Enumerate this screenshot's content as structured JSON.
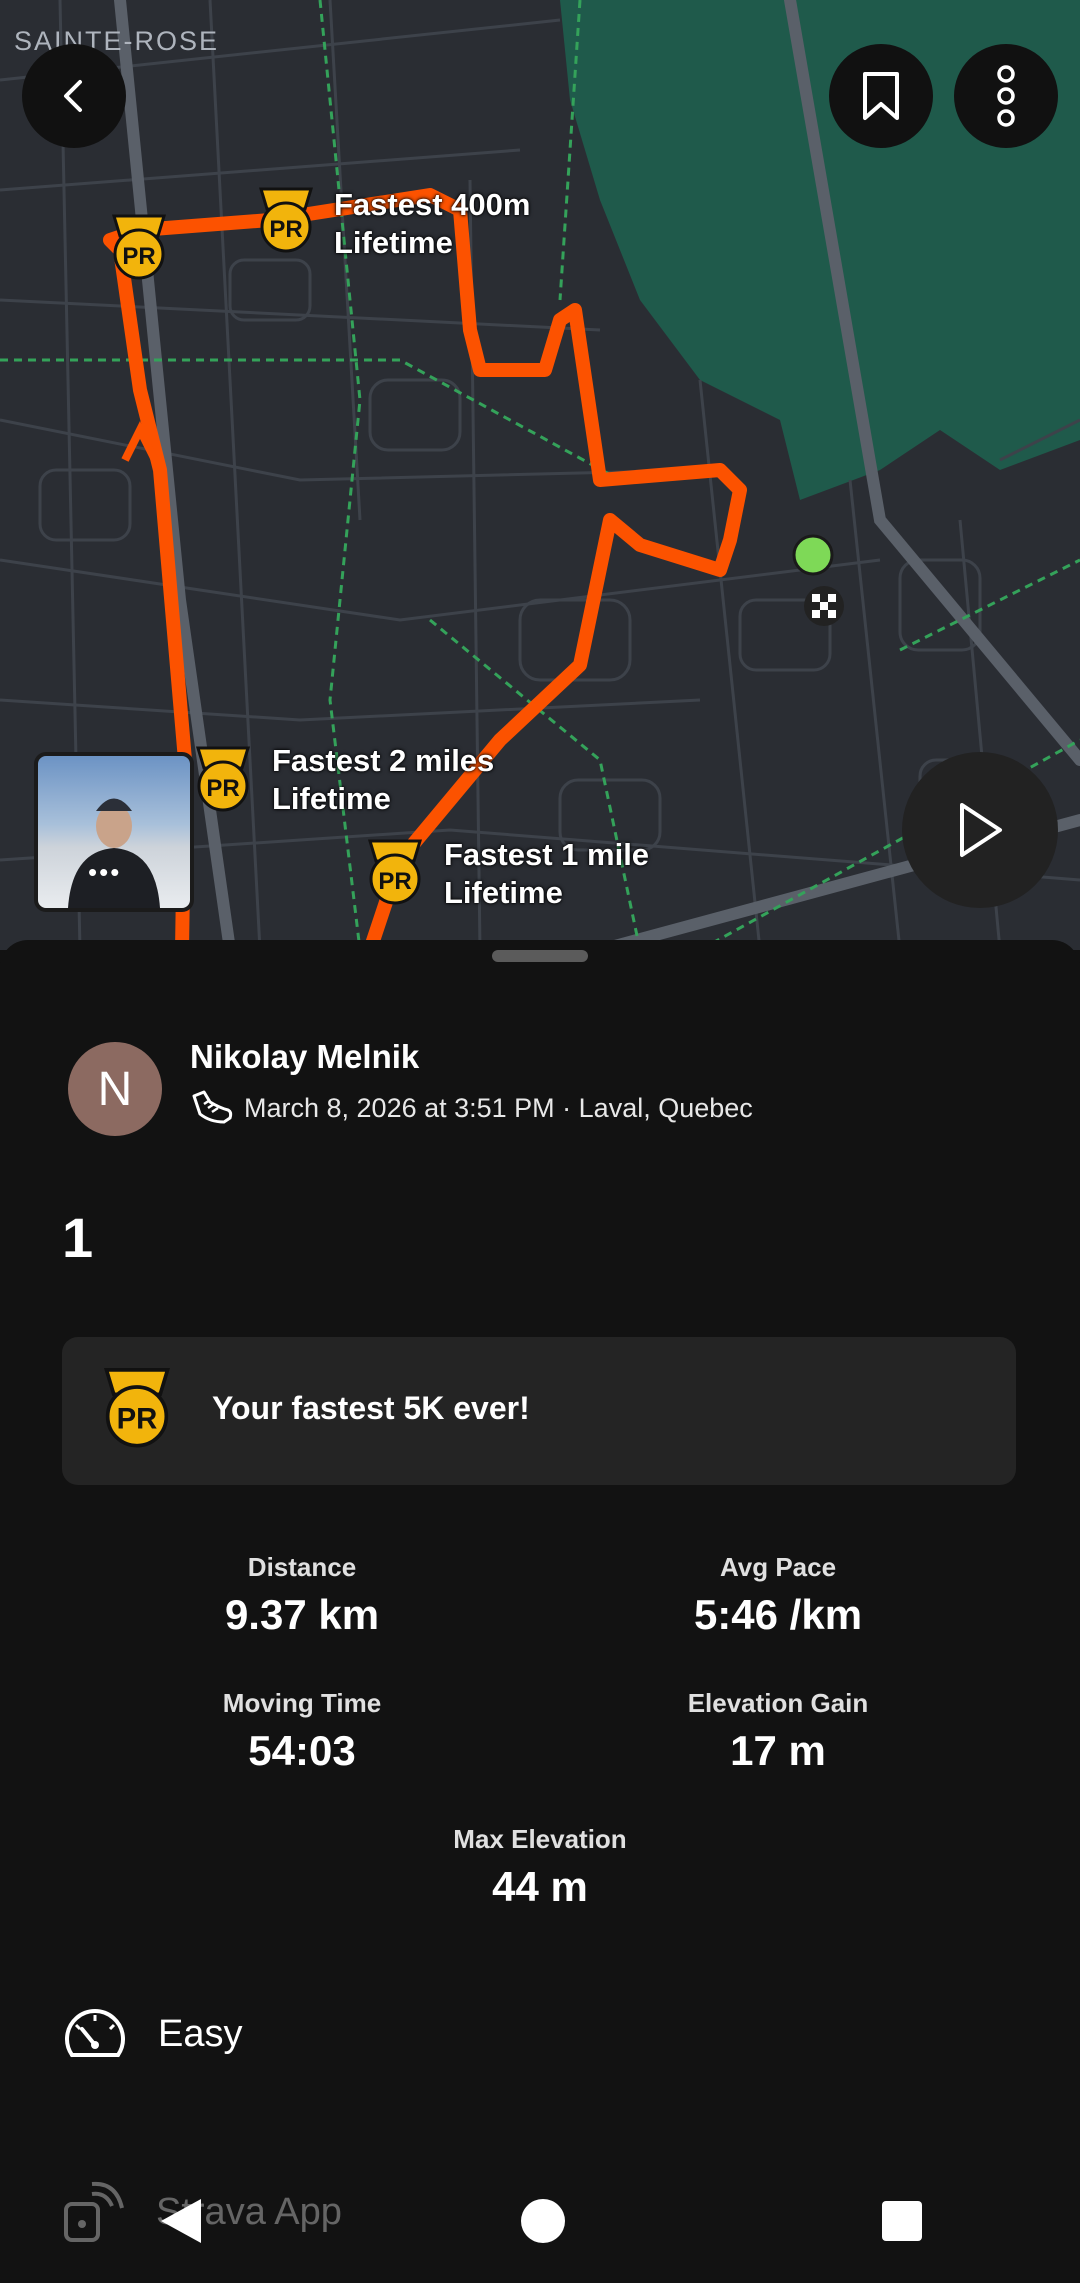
{
  "map": {
    "area_label": "SAINTE-ROSE",
    "pr_labels": [
      {
        "line1": "Fastest 400m",
        "line2": "Lifetime"
      },
      {
        "line1": "Fastest 2 miles",
        "line2": "Lifetime"
      },
      {
        "line1": "Fastest 1 mile",
        "line2": "Lifetime"
      }
    ],
    "pr_badge_text": "PR",
    "route_color": "#fc5200",
    "start_color": "#7ed957",
    "thumb_dots": "•••"
  },
  "activity": {
    "athlete_initial": "N",
    "athlete_name": "Nikolay Melnik",
    "meta": "March 8, 2026 at 3:51 PM · Laval, Quebec",
    "title": "1",
    "achievement": "Your fastest 5K ever!",
    "stats": [
      {
        "label": "Distance",
        "value": "9.37 km"
      },
      {
        "label": "Avg Pace",
        "value": "5:46 /km"
      },
      {
        "label": "Moving Time",
        "value": "54:03"
      },
      {
        "label": "Elevation Gain",
        "value": "17 m"
      },
      {
        "label": "Max Elevation",
        "value": "44 m"
      }
    ],
    "perceived_effort": "Easy",
    "app_name": "Strava App"
  },
  "icons": [
    "back-icon",
    "bookmark-icon",
    "more-icon",
    "play-icon",
    "shoe-icon",
    "gauge-icon",
    "device-icon",
    "nav-back-icon",
    "nav-home-icon",
    "nav-recents-icon"
  ]
}
